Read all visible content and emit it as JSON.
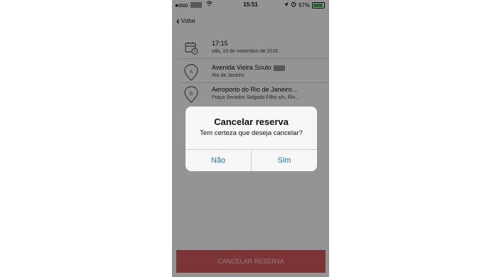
{
  "status_bar": {
    "time": "15:51",
    "signal": "●oooo",
    "battery_percent": "97%"
  },
  "nav": {
    "back_label": "Voltar"
  },
  "details": {
    "time": "17:15",
    "date": "sáb, 19 de novembro de 2016",
    "origin_name": "Avenida Vieira Souto",
    "origin_city": "Rio de Janeiro",
    "destination_name": "Aeroporto do Rio de Janeiro...",
    "destination_address": "Praça Senador Salgado Filho s/n, Rio..."
  },
  "cancel_button": {
    "label": "CANCELAR RESERVA"
  },
  "dialog": {
    "title": "Cancelar reserva",
    "message": "Tem certeza que deseja cancelar?",
    "no_label": "Não",
    "yes_label": "Sim"
  },
  "colors": {
    "accent": "#1a78c8",
    "cancel": "#d85a5a"
  }
}
